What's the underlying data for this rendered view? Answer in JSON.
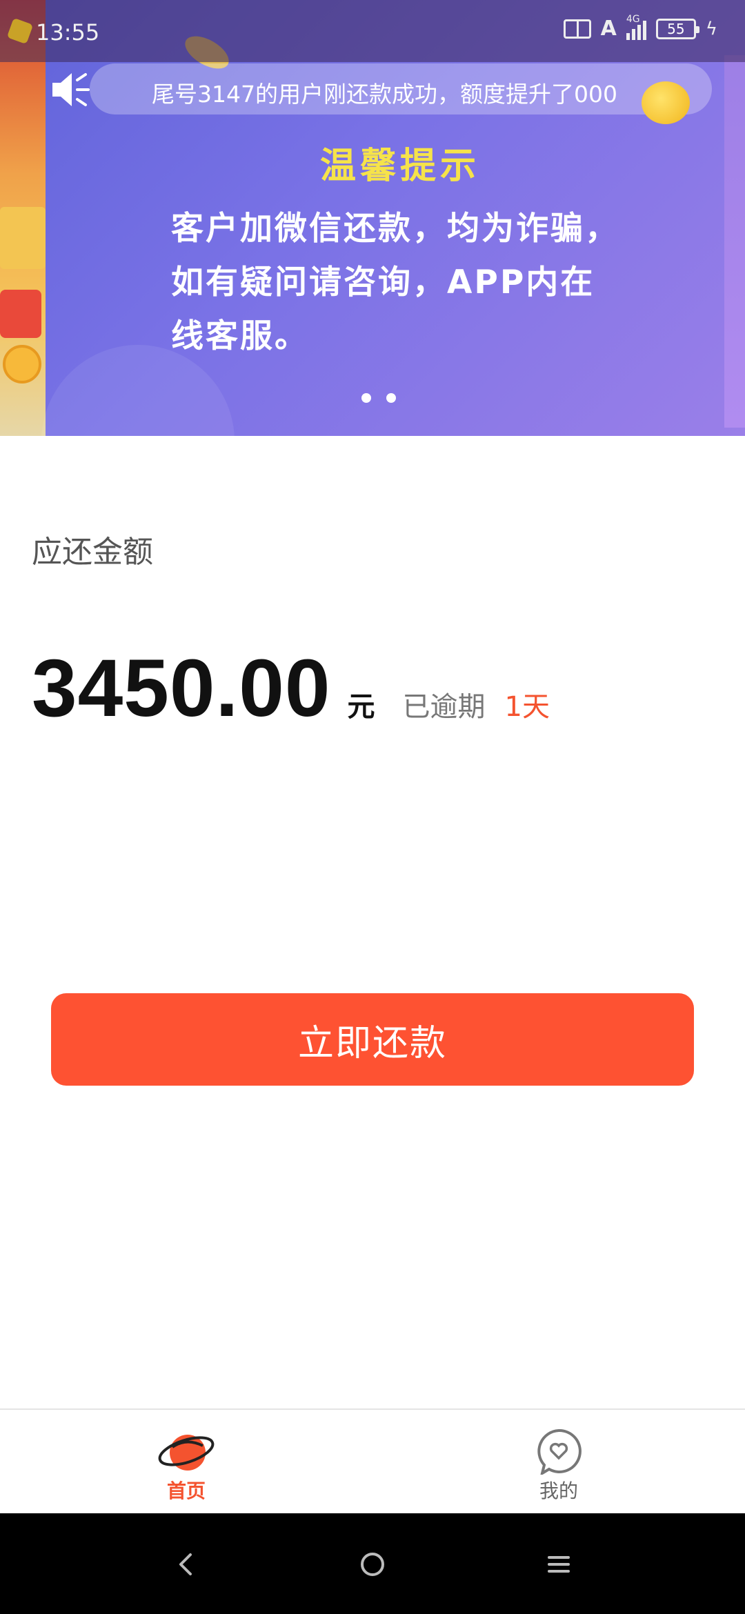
{
  "status_bar": {
    "time": "13:55",
    "network_type": "4G",
    "battery_level": "55"
  },
  "banner": {
    "marquee_text": "尾号3147的用户刚还款成功，额度提升了000",
    "tip_title": "温馨提示",
    "tip_lines": [
      "客户加微信还款，均为诈骗，",
      "如有疑问请咨询，APP内在",
      "线客服。"
    ],
    "page_count": 2,
    "colors": {
      "title": "#f6e34a",
      "background": "#7a72e6"
    }
  },
  "repayment": {
    "label": "应还金额",
    "amount": "3450.00",
    "unit": "元",
    "overdue_label": "已逾期",
    "overdue_days": "1天",
    "button_label": "立即还款",
    "colors": {
      "accent": "#fe5232",
      "overdue": "#f4532f"
    }
  },
  "tabbar": {
    "items": [
      {
        "label": "首页",
        "icon": "planet-icon",
        "active": true
      },
      {
        "label": "我的",
        "icon": "heart-chat-icon",
        "active": false
      }
    ]
  },
  "system_nav": {
    "icons": [
      "back-icon",
      "home-circle-icon",
      "menu-icon"
    ]
  }
}
